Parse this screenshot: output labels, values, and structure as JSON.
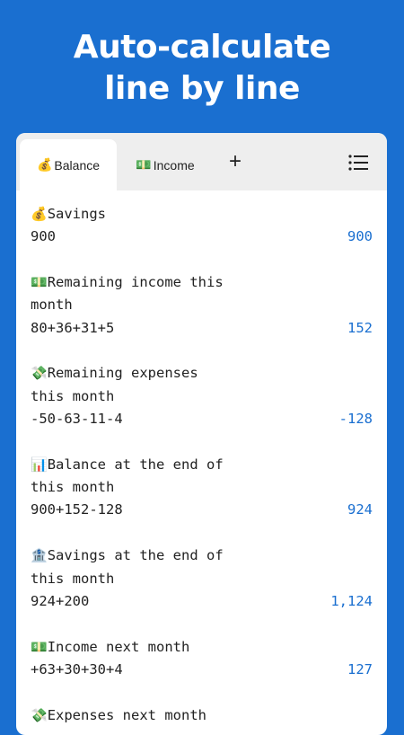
{
  "headline": {
    "line1": "Auto-calculate",
    "line2": "line by line"
  },
  "tabs": [
    {
      "icon": "💰",
      "label": "Balance",
      "active": true
    },
    {
      "icon": "💵",
      "label": "Income",
      "active": false
    }
  ],
  "toolbar": {
    "add_label": "+",
    "menu_icon": "list-icon"
  },
  "entries": [
    {
      "icon": "💰",
      "label_lines": [
        "Savings"
      ],
      "expression": "900",
      "result": "900"
    },
    {
      "icon": "💵",
      "label_lines": [
        "Remaining income this",
        "month"
      ],
      "expression": "80+36+31+5",
      "result": "152"
    },
    {
      "icon": "💸",
      "label_lines": [
        "Remaining expenses",
        "this month"
      ],
      "expression": "-50-63-11-4",
      "result": "-128"
    },
    {
      "icon": "📊",
      "label_lines": [
        "Balance at the end of",
        "this month"
      ],
      "expression": "900+152-128",
      "result": "924"
    },
    {
      "icon": "🏦",
      "label_lines": [
        "Savings at the end of",
        "this month"
      ],
      "expression": "924+200",
      "result": "1,124"
    },
    {
      "icon": "💵",
      "label_lines": [
        "Income next month"
      ],
      "expression": "+63+30+30+4",
      "result": "127"
    },
    {
      "icon": "💸",
      "label_lines": [
        "Expenses next month"
      ],
      "expression": "",
      "result": ""
    }
  ],
  "colors": {
    "brand": "#1a6fd0",
    "result": "#1a6fd0"
  }
}
